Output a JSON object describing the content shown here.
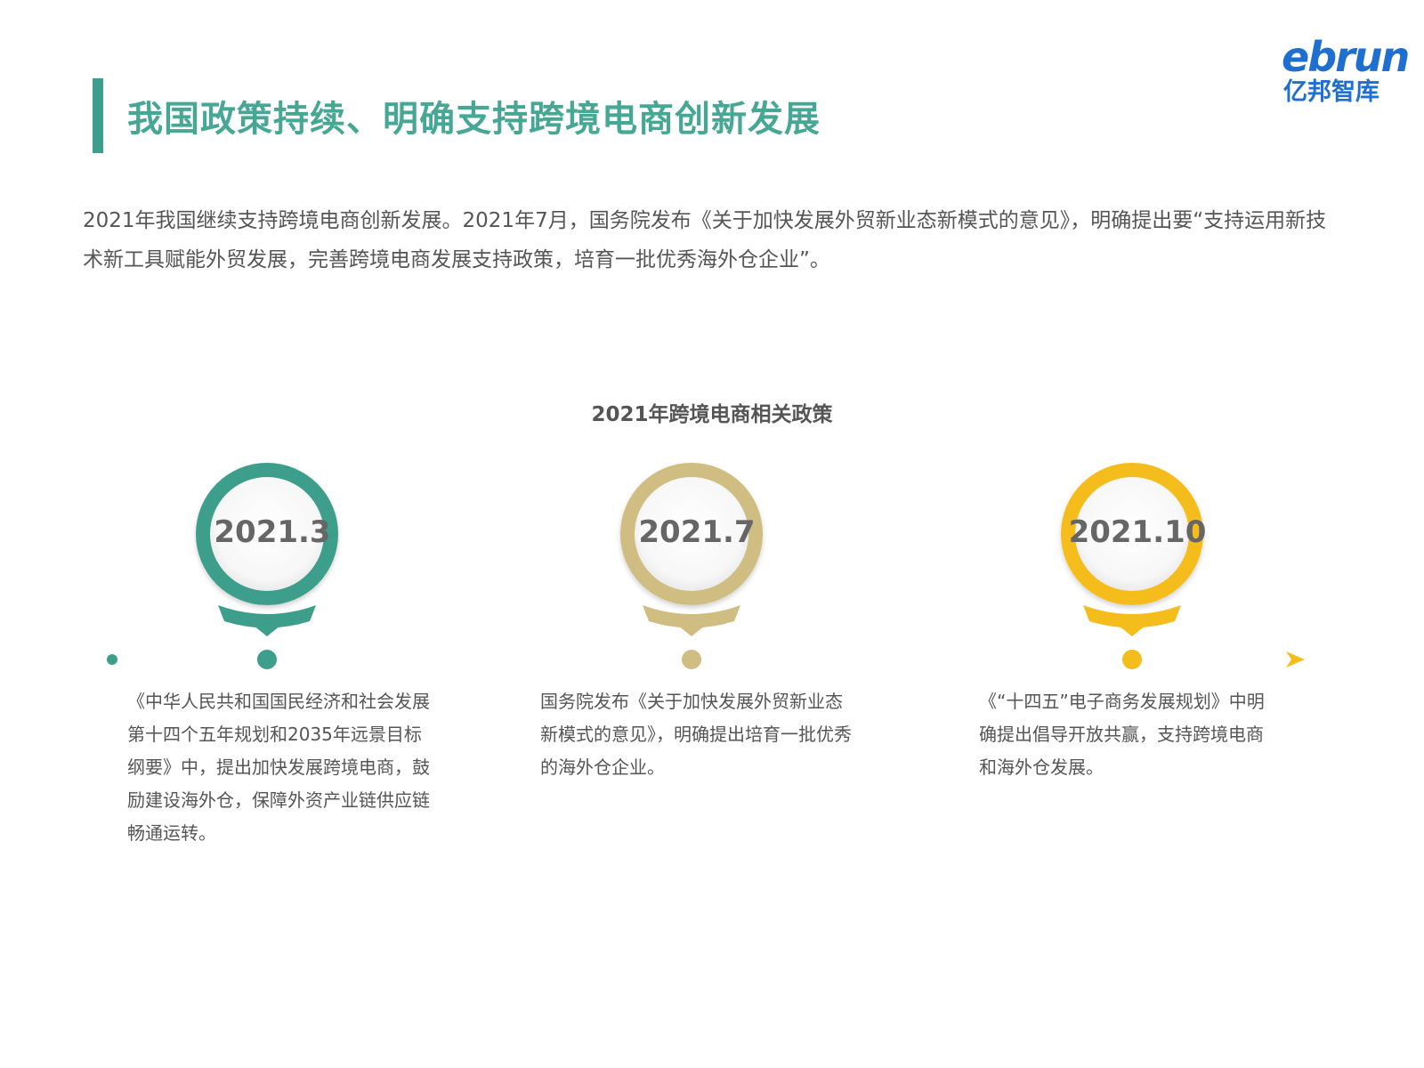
{
  "header": {
    "title": "我国政策持续、明确支持跨境电商创新发展",
    "accent_color": "#3d9e8c"
  },
  "logo": {
    "brand_top": "ebrun",
    "brand_bottom": "亿邦智库",
    "color": "#1f6fd1"
  },
  "intro": {
    "text": "2021年我国继续支持跨境电商创新发展。2021年7月，国务院发布《关于加快发展外贸新业态新模式的意见》，明确提出要“支持运用新技术新工具赋能外贸发展，完善跨境电商发展支持政策，培育一批优秀海外仓企业”。"
  },
  "timeline": {
    "title": "2021年跨境电商相关政策",
    "events": [
      {
        "date": "2021.3",
        "color": "#3d9e8c",
        "text": "《中华人民共和国国民经济和社会发展第十四个五年规划和2035年远景目标纲要》中，提出加快发展跨境电商，鼓励建设海外仓，保障外资产业链供应链畅通运转。"
      },
      {
        "date": "2021.7",
        "color": "#cfbd82",
        "text": "国务院发布《关于加快发展外贸新业态新模式的意见》，明确提出培育一批优秀的海外仓企业。"
      },
      {
        "date": "2021.10",
        "color": "#f5bd1c",
        "text": "《“十四五”电子商务发展规划》中明确提出倡导开放共赢，支持跨境电商和海外仓发展。"
      }
    ]
  }
}
